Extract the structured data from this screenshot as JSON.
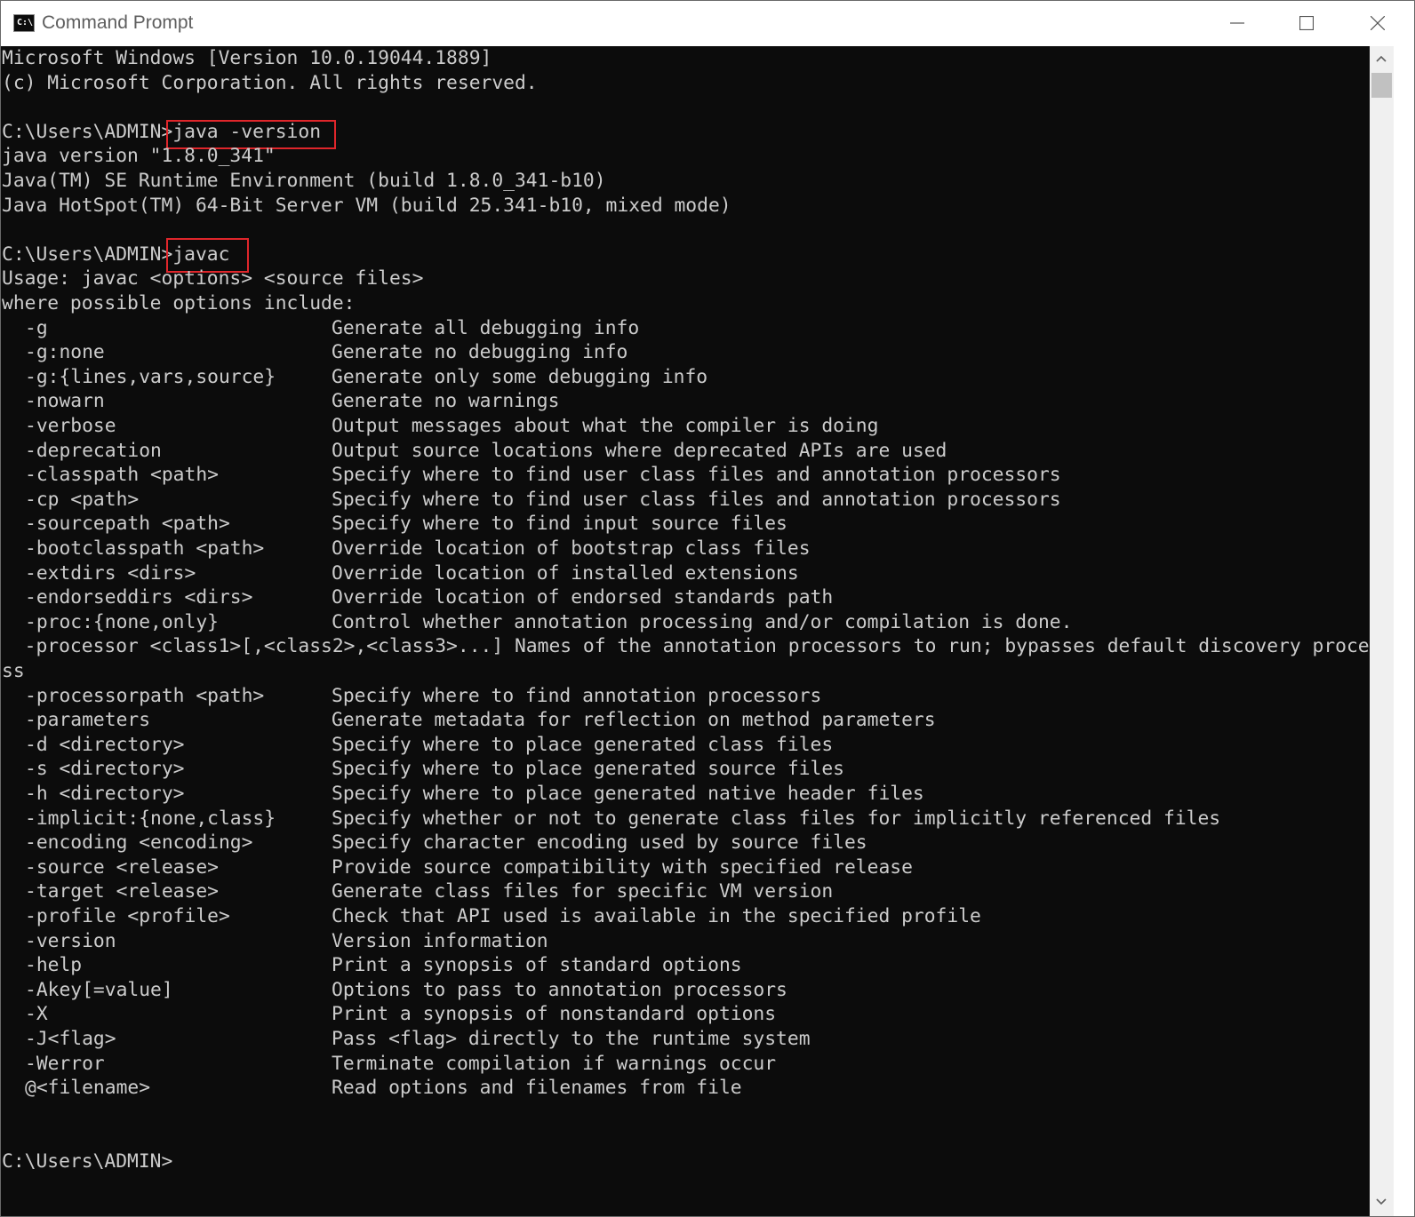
{
  "window": {
    "title": "Command Prompt",
    "icon_glyph": "C:\\",
    "controls": [
      "minimize-icon",
      "maximize-icon",
      "close-icon"
    ]
  },
  "console": {
    "header": [
      "Microsoft Windows [Version 10.0.19044.1889]",
      "(c) Microsoft Corporation. All rights reserved."
    ],
    "prompt": "C:\\Users\\ADMIN>",
    "cmd1": "java -version",
    "java_output": [
      "java version \"1.8.0_341\"",
      "Java(TM) SE Runtime Environment (build 1.8.0_341-b10)",
      "Java HotSpot(TM) 64-Bit Server VM (build 25.341-b10, mixed mode)"
    ],
    "cmd2": "javac",
    "usage": "Usage: javac <options> <source files>",
    "where": "where possible options include:",
    "options": [
      {
        "opt": "-g",
        "desc": "Generate all debugging info"
      },
      {
        "opt": "-g:none",
        "desc": "Generate no debugging info"
      },
      {
        "opt": "-g:{lines,vars,source}",
        "desc": "Generate only some debugging info"
      },
      {
        "opt": "-nowarn",
        "desc": "Generate no warnings"
      },
      {
        "opt": "-verbose",
        "desc": "Output messages about what the compiler is doing"
      },
      {
        "opt": "-deprecation",
        "desc": "Output source locations where deprecated APIs are used"
      },
      {
        "opt": "-classpath <path>",
        "desc": "Specify where to find user class files and annotation processors"
      },
      {
        "opt": "-cp <path>",
        "desc": "Specify where to find user class files and annotation processors"
      },
      {
        "opt": "-sourcepath <path>",
        "desc": "Specify where to find input source files"
      },
      {
        "opt": "-bootclasspath <path>",
        "desc": "Override location of bootstrap class files"
      },
      {
        "opt": "-extdirs <dirs>",
        "desc": "Override location of installed extensions"
      },
      {
        "opt": "-endorseddirs <dirs>",
        "desc": "Override location of endorsed standards path"
      },
      {
        "opt": "-proc:{none,only}",
        "desc": "Control whether annotation processing and/or compilation is done."
      }
    ],
    "processor_line": "  -processor <class1>[,<class2>,<class3>...] Names of the annotation processors to run; bypasses default discovery proce",
    "processor_wrap": "ss",
    "options2": [
      {
        "opt": "-processorpath <path>",
        "desc": "Specify where to find annotation processors"
      },
      {
        "opt": "-parameters",
        "desc": "Generate metadata for reflection on method parameters"
      },
      {
        "opt": "-d <directory>",
        "desc": "Specify where to place generated class files"
      },
      {
        "opt": "-s <directory>",
        "desc": "Specify where to place generated source files"
      },
      {
        "opt": "-h <directory>",
        "desc": "Specify where to place generated native header files"
      },
      {
        "opt": "-implicit:{none,class}",
        "desc": "Specify whether or not to generate class files for implicitly referenced files"
      },
      {
        "opt": "-encoding <encoding>",
        "desc": "Specify character encoding used by source files"
      },
      {
        "opt": "-source <release>",
        "desc": "Provide source compatibility with specified release"
      },
      {
        "opt": "-target <release>",
        "desc": "Generate class files for specific VM version"
      },
      {
        "opt": "-profile <profile>",
        "desc": "Check that API used is available in the specified profile"
      },
      {
        "opt": "-version",
        "desc": "Version information"
      },
      {
        "opt": "-help",
        "desc": "Print a synopsis of standard options"
      },
      {
        "opt": "-Akey[=value]",
        "desc": "Options to pass to annotation processors"
      },
      {
        "opt": "-X",
        "desc": "Print a synopsis of nonstandard options"
      },
      {
        "opt": "-J<flag>",
        "desc": "Pass <flag> directly to the runtime system"
      },
      {
        "opt": "-Werror",
        "desc": "Terminate compilation if warnings occur"
      },
      {
        "opt": "@<filename>",
        "desc": "Read options and filenames from file"
      }
    ],
    "final_prompt": "C:\\Users\\ADMIN>"
  },
  "colors": {
    "console_bg": "#0c0c0c",
    "console_text": "#cccccc",
    "highlight": "#e0262b"
  }
}
